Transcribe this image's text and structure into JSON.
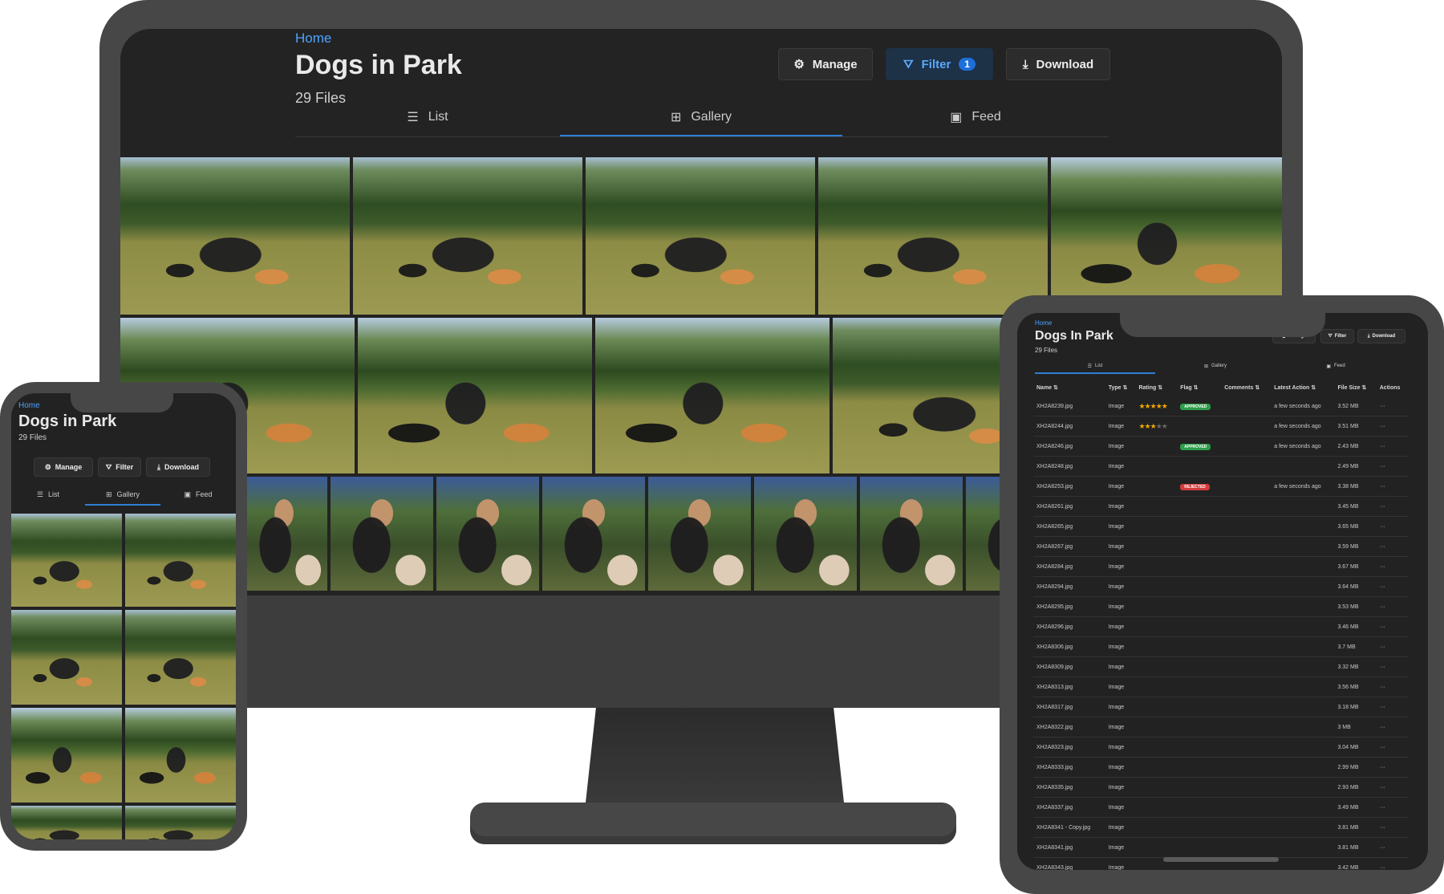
{
  "desktop": {
    "breadcrumb": "Home",
    "title": "Dogs in Park",
    "file_count": "29 Files",
    "buttons": {
      "manage": "Manage",
      "filter": "Filter",
      "filter_count": "1",
      "download": "Download"
    },
    "tabs": {
      "list": "List",
      "gallery": "Gallery",
      "feed": "Feed"
    }
  },
  "tablet": {
    "breadcrumb": "Home",
    "title": "Dogs In Park",
    "file_count": "29 Files",
    "buttons": {
      "manage": "Manage",
      "filter": "Filter",
      "download": "Download"
    },
    "tabs": {
      "list": "List",
      "gallery": "Gallery",
      "feed": "Feed"
    },
    "columns": [
      "Name ⇅",
      "Type ⇅",
      "Rating ⇅",
      "Flag ⇅",
      "Comments ⇅",
      "Latest Action ⇅",
      "File Size ⇅",
      "Actions"
    ],
    "rows": [
      {
        "name": "XH2A8239.jpg",
        "type": "Image",
        "rating": 5,
        "flag": "APPROVED",
        "action": "a few seconds ago",
        "size": "3.52 MB"
      },
      {
        "name": "XH2A8244.jpg",
        "type": "Image",
        "rating": 3,
        "flag": "",
        "action": "a few seconds ago",
        "size": "3.51 MB"
      },
      {
        "name": "XH2A8246.jpg",
        "type": "Image",
        "rating": 0,
        "flag": "APPROVED",
        "action": "a few seconds ago",
        "size": "2.43 MB"
      },
      {
        "name": "XH2A8248.jpg",
        "type": "Image",
        "rating": 0,
        "flag": "",
        "action": "",
        "size": "2.49 MB"
      },
      {
        "name": "XH2A8253.jpg",
        "type": "Image",
        "rating": 0,
        "flag": "REJECTED",
        "action": "a few seconds ago",
        "size": "3.38 MB"
      },
      {
        "name": "XH2A8261.jpg",
        "type": "Image",
        "rating": 0,
        "flag": "",
        "action": "",
        "size": "3.45 MB"
      },
      {
        "name": "XH2A8265.jpg",
        "type": "Image",
        "rating": 0,
        "flag": "",
        "action": "",
        "size": "3.65 MB"
      },
      {
        "name": "XH2A8267.jpg",
        "type": "Image",
        "rating": 0,
        "flag": "",
        "action": "",
        "size": "3.59 MB"
      },
      {
        "name": "XH2A8284.jpg",
        "type": "Image",
        "rating": 0,
        "flag": "",
        "action": "",
        "size": "3.67 MB"
      },
      {
        "name": "XH2A8294.jpg",
        "type": "Image",
        "rating": 0,
        "flag": "",
        "action": "",
        "size": "3.64 MB"
      },
      {
        "name": "XH2A8295.jpg",
        "type": "Image",
        "rating": 0,
        "flag": "",
        "action": "",
        "size": "3.53 MB"
      },
      {
        "name": "XH2A8296.jpg",
        "type": "Image",
        "rating": 0,
        "flag": "",
        "action": "",
        "size": "3.46 MB"
      },
      {
        "name": "XH2A8306.jpg",
        "type": "Image",
        "rating": 0,
        "flag": "",
        "action": "",
        "size": "3.7 MB"
      },
      {
        "name": "XH2A8309.jpg",
        "type": "Image",
        "rating": 0,
        "flag": "",
        "action": "",
        "size": "3.32 MB"
      },
      {
        "name": "XH2A8313.jpg",
        "type": "Image",
        "rating": 0,
        "flag": "",
        "action": "",
        "size": "3.56 MB"
      },
      {
        "name": "XH2A8317.jpg",
        "type": "Image",
        "rating": 0,
        "flag": "",
        "action": "",
        "size": "3.18 MB"
      },
      {
        "name": "XH2A8322.jpg",
        "type": "Image",
        "rating": 0,
        "flag": "",
        "action": "",
        "size": "3 MB"
      },
      {
        "name": "XH2A8323.jpg",
        "type": "Image",
        "rating": 0,
        "flag": "",
        "action": "",
        "size": "3.04 MB"
      },
      {
        "name": "XH2A8333.jpg",
        "type": "Image",
        "rating": 0,
        "flag": "",
        "action": "",
        "size": "2.99 MB"
      },
      {
        "name": "XH2A8335.jpg",
        "type": "Image",
        "rating": 0,
        "flag": "",
        "action": "",
        "size": "2.93 MB"
      },
      {
        "name": "XH2A8337.jpg",
        "type": "Image",
        "rating": 0,
        "flag": "",
        "action": "",
        "size": "3.49 MB"
      },
      {
        "name": "XH2A8341 - Copy.jpg",
        "type": "Image",
        "rating": 0,
        "flag": "",
        "action": "",
        "size": "3.81 MB"
      },
      {
        "name": "XH2A8341.jpg",
        "type": "Image",
        "rating": 0,
        "flag": "",
        "action": "",
        "size": "3.81 MB"
      },
      {
        "name": "XH2A8343.jpg",
        "type": "Image",
        "rating": 0,
        "flag": "",
        "action": "",
        "size": "3.42 MB"
      }
    ],
    "actions_glyph": "···"
  },
  "phone": {
    "breadcrumb": "Home",
    "title": "Dogs in Park",
    "file_count": "29 Files",
    "buttons": {
      "manage": "Manage",
      "filter": "Filter",
      "download": "Download"
    },
    "tabs": {
      "list": "List",
      "gallery": "Gallery",
      "feed": "Feed"
    }
  },
  "colors": {
    "accent": "#4ea3ff",
    "approved": "#2e9d4a",
    "rejected": "#d23b3b",
    "star": "#f0a500",
    "star_off": "#666666"
  }
}
